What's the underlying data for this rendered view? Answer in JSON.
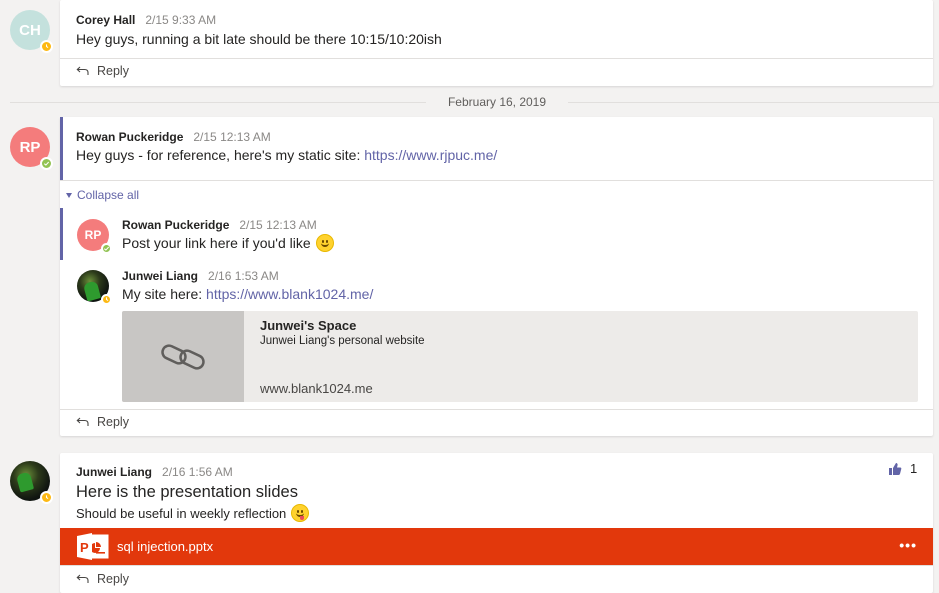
{
  "date_separator": "February 16, 2019",
  "reply_label": "Reply",
  "collapse_label": "Collapse all",
  "threads": [
    {
      "author": "Corey Hall",
      "initials": "CH",
      "time": "2/15 9:33 AM",
      "text": "Hey guys, running a bit late should be there 10:15/10:20ish",
      "status": "away"
    },
    {
      "author": "Rowan Puckeridge",
      "initials": "RP",
      "time": "2/15 12:13 AM",
      "text": "Hey guys - for reference, here's my static site: ",
      "link": "https://www.rjpuc.me/",
      "status": "online",
      "replies": [
        {
          "author": "Rowan Puckeridge",
          "initials": "RP",
          "time": "2/15 12:13 AM",
          "text": "Post your link here if you'd like",
          "emoji": "smile-emoji",
          "status": "online"
        },
        {
          "author": "Junwei Liang",
          "time": "2/16 1:53 AM",
          "text": "My site here: ",
          "link": "https://www.blank1024.me/",
          "status": "away",
          "preview": {
            "title": "Junwei's Space",
            "description": "Junwei Liang's personal website",
            "url": "www.blank1024.me",
            "icon": "link-icon"
          }
        }
      ]
    },
    {
      "author": "Junwei Liang",
      "time": "2/16 1:56 AM",
      "subject": "Here is the presentation slides",
      "text": "Should be useful in weekly reflection",
      "emoji": "yum-emoji",
      "status": "away",
      "like_count": "1",
      "attachment": {
        "name": "sql injection.pptx",
        "icon": "powerpoint-icon",
        "more": "•••",
        "color": "#e2380c"
      }
    }
  ],
  "colors": {
    "accent": "#6264a7",
    "background": "#f3f2f1",
    "ch_avatar": "#c4e1dd",
    "rp_avatar": "#f47c7c"
  }
}
